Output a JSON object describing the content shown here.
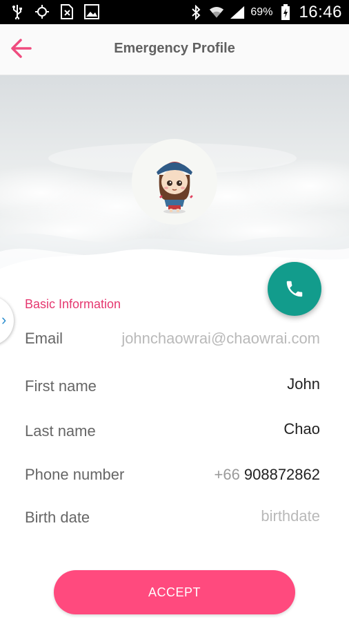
{
  "status_bar": {
    "battery_percent": "69%",
    "time": "16:46",
    "icons": [
      "usb-icon",
      "gps-icon",
      "sim-off-icon",
      "image-icon",
      "bluetooth-icon",
      "wifi-icon",
      "signal-icon",
      "battery-charging-icon"
    ]
  },
  "app_bar": {
    "title": "Emergency Profile",
    "back_icon": "arrow-left-icon"
  },
  "profile": {
    "avatar": "cartoon-girl-avatar",
    "call_icon": "phone-icon"
  },
  "section": {
    "title": "Basic Information"
  },
  "fields": {
    "email": {
      "label": "Email",
      "value": "johnchaowrai@chaowrai.com"
    },
    "first_name": {
      "label": "First name",
      "value": "John"
    },
    "last_name": {
      "label": "Last name",
      "value": "Chao"
    },
    "phone": {
      "label": "Phone number",
      "prefix": "+66",
      "value": "908872862"
    },
    "birth_date": {
      "label": "Birth date",
      "placeholder": "birthdate"
    }
  },
  "accept_button": {
    "label": "ACCEPT"
  },
  "colors": {
    "accent_pink": "#e5376f",
    "button_pink": "#ff4a7e",
    "fab_teal": "#129c8c",
    "side_tab_blue": "#2e8fcf"
  }
}
